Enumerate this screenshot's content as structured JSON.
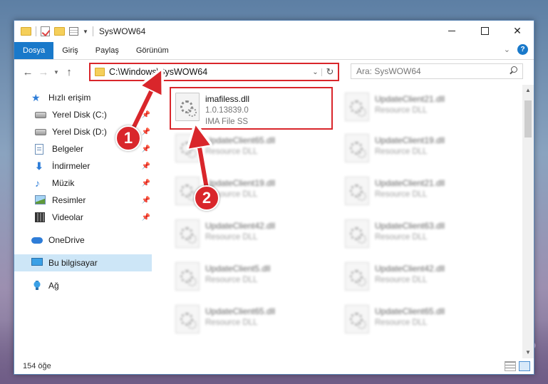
{
  "window": {
    "title": "SysWOW64",
    "controls": {
      "minimize": "",
      "maximize": "",
      "close": "✕"
    }
  },
  "ribbon": {
    "tabs": [
      {
        "label": "Dosya",
        "active": true
      },
      {
        "label": "Giriş",
        "active": false
      },
      {
        "label": "Paylaş",
        "active": false
      },
      {
        "label": "Görünüm",
        "active": false
      }
    ],
    "help": "?"
  },
  "navbar": {
    "address": "C:\\Windows\\SysWOW64",
    "search_placeholder": "Ara: SysWOW64"
  },
  "sidebar": {
    "items": [
      {
        "label": "Hızlı erişim",
        "icon": "star-icon",
        "pinned": false
      },
      {
        "label": "Yerel Disk (C:)",
        "icon": "drive-icon",
        "pinned": true
      },
      {
        "label": "Yerel Disk (D:)",
        "icon": "drive-icon",
        "pinned": true
      },
      {
        "label": "Belgeler",
        "icon": "document-icon",
        "pinned": true
      },
      {
        "label": "İndirmeler",
        "icon": "download-icon",
        "pinned": true
      },
      {
        "label": "Müzik",
        "icon": "music-icon",
        "pinned": true
      },
      {
        "label": "Resimler",
        "icon": "pictures-icon",
        "pinned": true
      },
      {
        "label": "Videolar",
        "icon": "video-icon",
        "pinned": true
      },
      {
        "label": "OneDrive",
        "icon": "cloud-icon"
      },
      {
        "label": "Bu bilgisayar",
        "icon": "computer-icon",
        "selected": true
      },
      {
        "label": "Ağ",
        "icon": "network-icon"
      }
    ]
  },
  "files": [
    {
      "name": "imafiless.dll",
      "line2": "1.0.13839.0",
      "line3": "IMA File SS",
      "highlighted": true
    },
    {
      "name": "UpdateClient21.dll",
      "line2": "Resource DLL"
    },
    {
      "name": "UpdateClient65.dll",
      "line2": "Resource DLL"
    },
    {
      "name": "UpdateClient19.dll",
      "line2": "Resource DLL"
    },
    {
      "name": "UpdateClient19.dll",
      "line2": "Resource DLL"
    },
    {
      "name": "UpdateClient21.dll",
      "line2": "Resource DLL"
    },
    {
      "name": "UpdateClient42.dll",
      "line2": "Resource DLL"
    },
    {
      "name": "UpdateClient63.dll",
      "line2": "Resource DLL"
    },
    {
      "name": "UpdateClient5.dll",
      "line2": "Resource DLL"
    },
    {
      "name": "UpdateClient42.dll",
      "line2": "Resource DLL"
    },
    {
      "name": "UpdateClient65.dll",
      "line2": "Resource DLL"
    },
    {
      "name": "UpdateClient65.dll",
      "line2": "Resource DLL"
    }
  ],
  "status": {
    "count": "154 öğe"
  },
  "callouts": [
    {
      "number": "1"
    },
    {
      "number": "2"
    }
  ],
  "colors": {
    "accent": "#1979ca",
    "callout": "#d9262b",
    "selected": "#cde6f7"
  }
}
